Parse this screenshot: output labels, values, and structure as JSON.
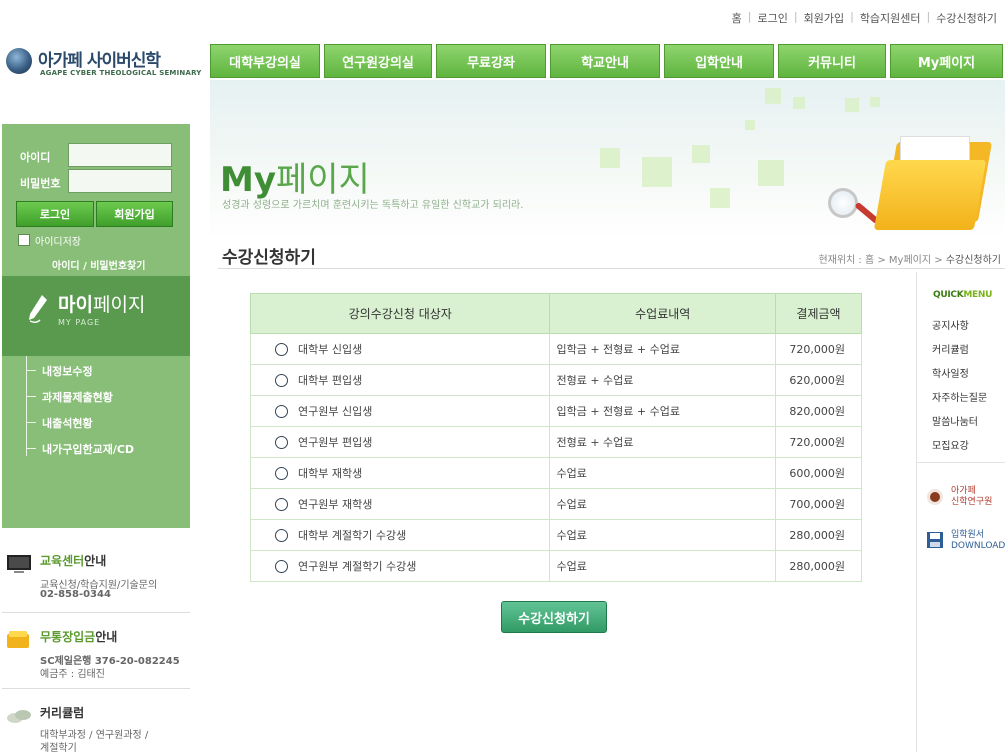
{
  "header": {
    "top_links": [
      "홈",
      "로그인",
      "회원가입",
      "학습지원센터",
      "수강신청하기"
    ],
    "logo_name": "아가페 사이버신학",
    "logo_sub": "AGAPE CYBER THEOLOGICAL SEMINARY",
    "gnb": [
      "대학부강의실",
      "연구원강의실",
      "무료강좌",
      "학교안내",
      "입학안내",
      "커뮤니티",
      "My페이지"
    ]
  },
  "banner": {
    "title_bold": "My",
    "title_rest": "페이지",
    "subtitle": "성경과 성령으로 가르치며 훈련시키는 독특하고 유일한 신학교가 되리라."
  },
  "section": {
    "title": "수강신청하기",
    "breadcrumb_prefix": "현재위치 : 홈 > My페이지 > ",
    "breadcrumb_current": "수강신청하기"
  },
  "login": {
    "id_label": "아이디",
    "pw_label": "비밀번호",
    "id_value": "",
    "pw_value": "",
    "login_button": "로그인",
    "join_button": "회원가입",
    "save_id_label": "아이디저장",
    "find_link": "아이디 / 비밀번호찾기"
  },
  "mypage": {
    "title_bold": "마이",
    "title_rest": "페이지",
    "sub": "MY PAGE",
    "menu": [
      "내정보수정",
      "과제물제출현황",
      "내출석현황",
      "내가구입한교재/CD"
    ]
  },
  "side_info": {
    "edu": {
      "head_hl": "교육센터",
      "head_rest": "안내",
      "line1": "교육신청/학습지원/기술문의",
      "line2": "02-858-0344"
    },
    "bank": {
      "head_hl": "무통장입금",
      "head_rest": "안내",
      "line1": "SC제일은행 376-20-082245",
      "line2": "예금주 : 김태진"
    },
    "curri": {
      "head": "커리큘럼",
      "line1": "대학부과정 / 연구원과정 /",
      "line2": "계절학기"
    }
  },
  "table": {
    "headers": [
      "강의수강신청 대상자",
      "수업료내역",
      "결제금액"
    ],
    "rows": [
      {
        "target": "대학부 신입생",
        "fee": "입학금 + 전형료 + 수업료",
        "amount": "720,000원"
      },
      {
        "target": "대학부 편입생",
        "fee": "전형료 + 수업료",
        "amount": "620,000원"
      },
      {
        "target": "연구원부 신입생",
        "fee": "입학금 + 전형료 + 수업료",
        "amount": "820,000원"
      },
      {
        "target": "연구원부 편입생",
        "fee": "전형료 + 수업료",
        "amount": "720,000원"
      },
      {
        "target": "대학부 재학생",
        "fee": "수업료",
        "amount": "600,000원"
      },
      {
        "target": "연구원부 재학생",
        "fee": "수업료",
        "amount": "700,000원"
      },
      {
        "target": "대학부 계절학기 수강생",
        "fee": "수업료",
        "amount": "280,000원"
      },
      {
        "target": "연구원부 계절학기 수강생",
        "fee": "수업료",
        "amount": "280,000원"
      }
    ],
    "apply_button": "수강신청하기"
  },
  "quick": {
    "title_a": "QUICK",
    "title_b": "MENU",
    "items": [
      "공지사항",
      "커리큘럼",
      "학사일정",
      "자주하는질문",
      "말씀나눔터",
      "모집요강"
    ],
    "lab_line1": "아가페",
    "lab_line2": "신학연구원",
    "dl_line1": "입학원서",
    "dl_line2": "DOWNLOAD"
  },
  "colors": {
    "gnb_green": "#5fb43f",
    "sidebar_green": "#88be78",
    "sidebar_dark": "#5a9a4f",
    "table_header": "#d9f1d1",
    "apply_button": "#319a65"
  }
}
